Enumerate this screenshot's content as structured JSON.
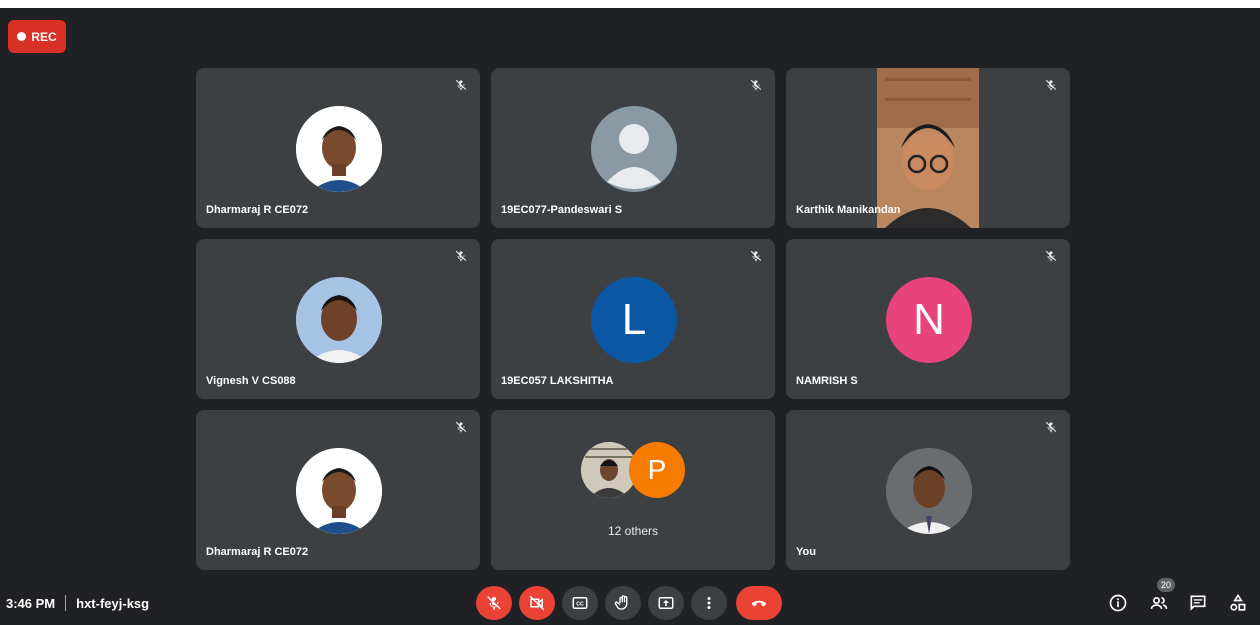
{
  "recording": {
    "label": "REC"
  },
  "tiles": [
    {
      "name": "Dharmaraj R CE072"
    },
    {
      "name": "19EC077-Pandeswari S"
    },
    {
      "name": "Karthik Manikandan"
    },
    {
      "name": "Vignesh V CS088"
    },
    {
      "name": "19EC057 LAKSHITHA",
      "initial": "L",
      "color": "#0b57a4"
    },
    {
      "name": "NAMRISH S",
      "initial": "N",
      "color": "#e8437b"
    },
    {
      "name": "Dharmaraj R CE072"
    },
    {
      "others_label": "12 others",
      "initial": "P",
      "color": "#f57c00"
    },
    {
      "name": "You"
    }
  ],
  "meeting": {
    "time": "3:46 PM",
    "code": "hxt-feyj-ksg"
  },
  "participants_count": "20",
  "colors": {
    "background": "#202124",
    "tile": "#3c4043",
    "danger": "#ea4335"
  },
  "icons": {
    "tile_mute": "mic-off-icon",
    "controls": [
      "mic-off-icon",
      "camera-off-icon",
      "captions-icon",
      "raise-hand-icon",
      "present-screen-icon",
      "more-options-icon",
      "hangup-icon"
    ],
    "right": [
      "info-icon",
      "people-icon",
      "chat-icon",
      "activities-icon"
    ]
  }
}
